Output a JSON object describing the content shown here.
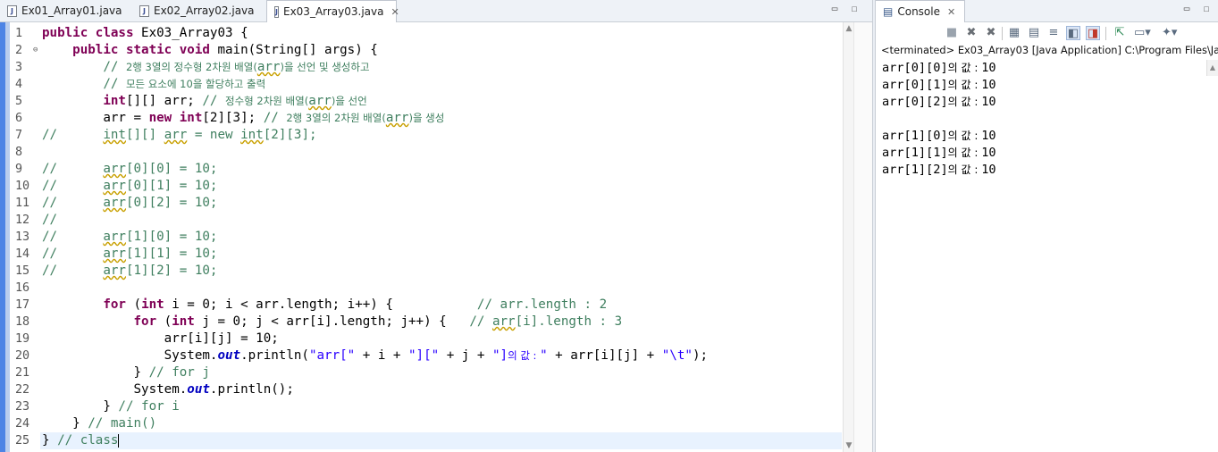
{
  "editor": {
    "tabs": [
      {
        "label": "Ex01_Array01.java",
        "active": false
      },
      {
        "label": "Ex02_Array02.java",
        "active": false
      },
      {
        "label": "Ex03_Array03.java",
        "active": true
      }
    ],
    "line_numbers": [
      "1",
      "2",
      "3",
      "4",
      "5",
      "6",
      "7",
      "8",
      "9",
      "10",
      "11",
      "12",
      "13",
      "14",
      "15",
      "16",
      "17",
      "18",
      "19",
      "20",
      "21",
      "22",
      "23",
      "24",
      "25"
    ],
    "code": [
      [
        {
          "t": "kw",
          "v": "public class"
        },
        {
          "t": "",
          "v": " Ex03_Array03 {"
        }
      ],
      [
        {
          "t": "",
          "v": "    "
        },
        {
          "t": "kw",
          "v": "public static void"
        },
        {
          "t": "",
          "v": " main(String[] args) {"
        }
      ],
      [
        {
          "t": "cm",
          "v": "        // "
        },
        {
          "t": "cmko",
          "v": "2행 3열의 정수형 2차원 배열("
        },
        {
          "t": "cmsq",
          "v": "arr"
        },
        {
          "t": "cmko",
          "v": ")을 선언 및 생성하고"
        }
      ],
      [
        {
          "t": "cm",
          "v": "        // "
        },
        {
          "t": "cmko",
          "v": "모든 요소에 10을 할당하고 출력"
        }
      ],
      [
        {
          "t": "",
          "v": "        "
        },
        {
          "t": "kw",
          "v": "int"
        },
        {
          "t": "",
          "v": "[][] arr; "
        },
        {
          "t": "cm",
          "v": "// "
        },
        {
          "t": "cmko",
          "v": "정수형 2차원 배열("
        },
        {
          "t": "cmsq",
          "v": "arr"
        },
        {
          "t": "cmko",
          "v": ")을 선언"
        }
      ],
      [
        {
          "t": "",
          "v": "        arr = "
        },
        {
          "t": "kw",
          "v": "new int"
        },
        {
          "t": "",
          "v": "[2][3]; "
        },
        {
          "t": "cm",
          "v": "// "
        },
        {
          "t": "cmko",
          "v": "2행 3열의 2차원 배열("
        },
        {
          "t": "cmsq",
          "v": "arr"
        },
        {
          "t": "cmko",
          "v": ")을 생성"
        }
      ],
      [
        {
          "t": "cm",
          "v": "//      "
        },
        {
          "t": "cmsq",
          "v": "int"
        },
        {
          "t": "cm",
          "v": "[][] "
        },
        {
          "t": "cmsq",
          "v": "arr"
        },
        {
          "t": "cm",
          "v": " = new "
        },
        {
          "t": "cmsq",
          "v": "int"
        },
        {
          "t": "cm",
          "v": "[2][3];"
        }
      ],
      [
        {
          "t": "",
          "v": ""
        }
      ],
      [
        {
          "t": "cm",
          "v": "//      "
        },
        {
          "t": "cmsq",
          "v": "arr"
        },
        {
          "t": "cm",
          "v": "[0][0] = 10;"
        }
      ],
      [
        {
          "t": "cm",
          "v": "//      "
        },
        {
          "t": "cmsq",
          "v": "arr"
        },
        {
          "t": "cm",
          "v": "[0][1] = 10;"
        }
      ],
      [
        {
          "t": "cm",
          "v": "//      "
        },
        {
          "t": "cmsq",
          "v": "arr"
        },
        {
          "t": "cm",
          "v": "[0][2] = 10;"
        }
      ],
      [
        {
          "t": "cm",
          "v": "//"
        }
      ],
      [
        {
          "t": "cm",
          "v": "//      "
        },
        {
          "t": "cmsq",
          "v": "arr"
        },
        {
          "t": "cm",
          "v": "[1][0] = 10;"
        }
      ],
      [
        {
          "t": "cm",
          "v": "//      "
        },
        {
          "t": "cmsq",
          "v": "arr"
        },
        {
          "t": "cm",
          "v": "[1][1] = 10;"
        }
      ],
      [
        {
          "t": "cm",
          "v": "//      "
        },
        {
          "t": "cmsq",
          "v": "arr"
        },
        {
          "t": "cm",
          "v": "[1][2] = 10;"
        }
      ],
      [
        {
          "t": "",
          "v": ""
        }
      ],
      [
        {
          "t": "",
          "v": "        "
        },
        {
          "t": "kw",
          "v": "for"
        },
        {
          "t": "",
          "v": " ("
        },
        {
          "t": "kw",
          "v": "int"
        },
        {
          "t": "",
          "v": " i = 0; i < arr.length; i++) {           "
        },
        {
          "t": "cm",
          "v": "// arr.length : 2"
        }
      ],
      [
        {
          "t": "",
          "v": "            "
        },
        {
          "t": "kw",
          "v": "for"
        },
        {
          "t": "",
          "v": " ("
        },
        {
          "t": "kw",
          "v": "int"
        },
        {
          "t": "",
          "v": " j = 0; j < arr[i].length; j++) {   "
        },
        {
          "t": "cm",
          "v": "// "
        },
        {
          "t": "cmsq",
          "v": "arr"
        },
        {
          "t": "cm",
          "v": "[i].length : 3"
        }
      ],
      [
        {
          "t": "",
          "v": "                arr[i][j] = 10;"
        }
      ],
      [
        {
          "t": "",
          "v": "                System."
        },
        {
          "t": "fld",
          "v": "out"
        },
        {
          "t": "",
          "v": ".println("
        },
        {
          "t": "st",
          "v": "\"arr[\""
        },
        {
          "t": "",
          "v": " + i + "
        },
        {
          "t": "st",
          "v": "\"][\""
        },
        {
          "t": "",
          "v": " + j + "
        },
        {
          "t": "st",
          "v": "\"]"
        },
        {
          "t": "stko",
          "v": "의 값 : "
        },
        {
          "t": "st",
          "v": "\""
        },
        {
          "t": "",
          "v": " + arr[i][j] + "
        },
        {
          "t": "st",
          "v": "\"\\t\""
        },
        {
          "t": "",
          "v": ");"
        }
      ],
      [
        {
          "t": "",
          "v": "            } "
        },
        {
          "t": "cm",
          "v": "// for j"
        }
      ],
      [
        {
          "t": "",
          "v": "            System."
        },
        {
          "t": "fld",
          "v": "out"
        },
        {
          "t": "",
          "v": ".println();"
        }
      ],
      [
        {
          "t": "",
          "v": "        } "
        },
        {
          "t": "cm",
          "v": "// for i"
        }
      ],
      [
        {
          "t": "",
          "v": "    } "
        },
        {
          "t": "cm",
          "v": "// main()"
        }
      ],
      [
        {
          "t": "",
          "v": "} "
        },
        {
          "t": "cm",
          "v": "// class"
        },
        {
          "t": "cursor",
          "v": ""
        }
      ]
    ],
    "current_line": 25
  },
  "console": {
    "tab_label": "Console",
    "terminated_line": "<terminated> Ex03_Array03 [Java Application] C:\\Program Files\\Jav",
    "output": [
      "arr[0][0]의 값 : 10",
      "arr[0][1]의 값 : 10",
      "arr[0][2]의 값 : 10",
      "",
      "arr[1][0]의 값 : 10",
      "arr[1][1]의 값 : 10",
      "arr[1][2]의 값 : 10"
    ]
  },
  "colors": {
    "keyword": "#7f0055",
    "comment": "#3f7f5f",
    "string": "#2a00ff",
    "field": "#0000c0"
  }
}
